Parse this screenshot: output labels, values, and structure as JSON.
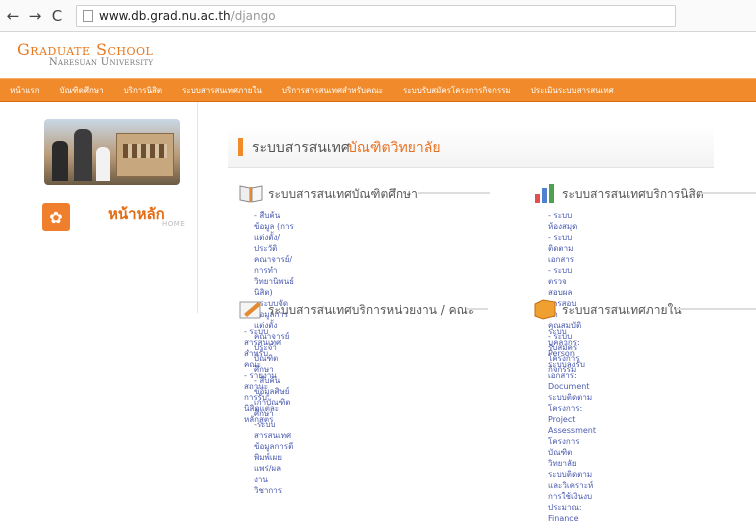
{
  "browser": {
    "back_glyph": "←",
    "forward_glyph": "→",
    "reload_glyph": "C",
    "url_host": "www.db.grad.nu.ac.th",
    "url_path": "/django"
  },
  "header": {
    "logo_main": "Graduate School",
    "logo_sub": "Naresuan University"
  },
  "navbar": {
    "items": [
      "หน้าแรก",
      "บัณฑิตศึกษา",
      "บริการนิสิต",
      "ระบบสารสนเทศภายใน",
      "บริการสารสนเทศสำหรับคณะ",
      "ระบบรับสมัครโครงการกิจกรรม",
      "ประเมินระบบสารสนเทศ"
    ]
  },
  "left": {
    "home_title": "หน้าหลัก",
    "home_en": "HOME"
  },
  "banner": {
    "part1": "ระบบสารสนเทศ",
    "part2": "บัณฑิตวิทยาลัย"
  },
  "sections": {
    "graduate": {
      "title": "ระบบสารสนเทศบัณฑิตศึกษา",
      "items": [
        "- สืบค้นข้อมูล (การแต่งตั้ง/ประวัติคณาจารย์/การทำ",
        "วิทยานิพนธ์นิสิต)",
        "- ระบบจัดข้อมูลการแต่งตั้งคณาจารย์ประจำบัณฑิตศึกษา",
        "- สืบค้นข้อมูลศิษย์เก่าบัณฑิตศึกษา",
        "-ระบบสารสนเทศข้อมูลการตีพิมพ์เผยแพร่/ผลงานวิชาการ"
      ]
    },
    "student": {
      "title": "ระบบสารสนเทศบริการนิสิต",
      "items": [
        "- ระบบห้องสมุด",
        "- ระบบติดตามเอกสาร",
        "- ระบบตรวจสอบผลการสอบวัด",
        "คุณสมบัติ",
        "- ระบบรับสมัครโครงการกิจกรรม"
      ]
    },
    "faculty": {
      "title": "ระบบสารสนเทศบริการหน่วยงาน / คณะ",
      "items": [
        "- ระบบสารสนเทศสำหรับคณะ",
        "- รายงานสถานะการรับนิสิตแต่ละ",
        "หลักสูตร"
      ]
    },
    "internal": {
      "title": "ระบบสารสนเทศภายใน",
      "items": [
        "ระบบบุคลากร: Person",
        "ระบบลงรับเอกสาร: Document",
        "ระบบติดตามโครงการ: Project Assessment",
        "โครงการบัณฑิตวิทยาลัย",
        "ระบบติดตาม และวิเคราะห์การใช้เงินงบประมาณ:",
        "Finance"
      ]
    }
  },
  "colors": {
    "brand_orange": "#f08a2a",
    "link_blue": "#4b5bb0"
  }
}
